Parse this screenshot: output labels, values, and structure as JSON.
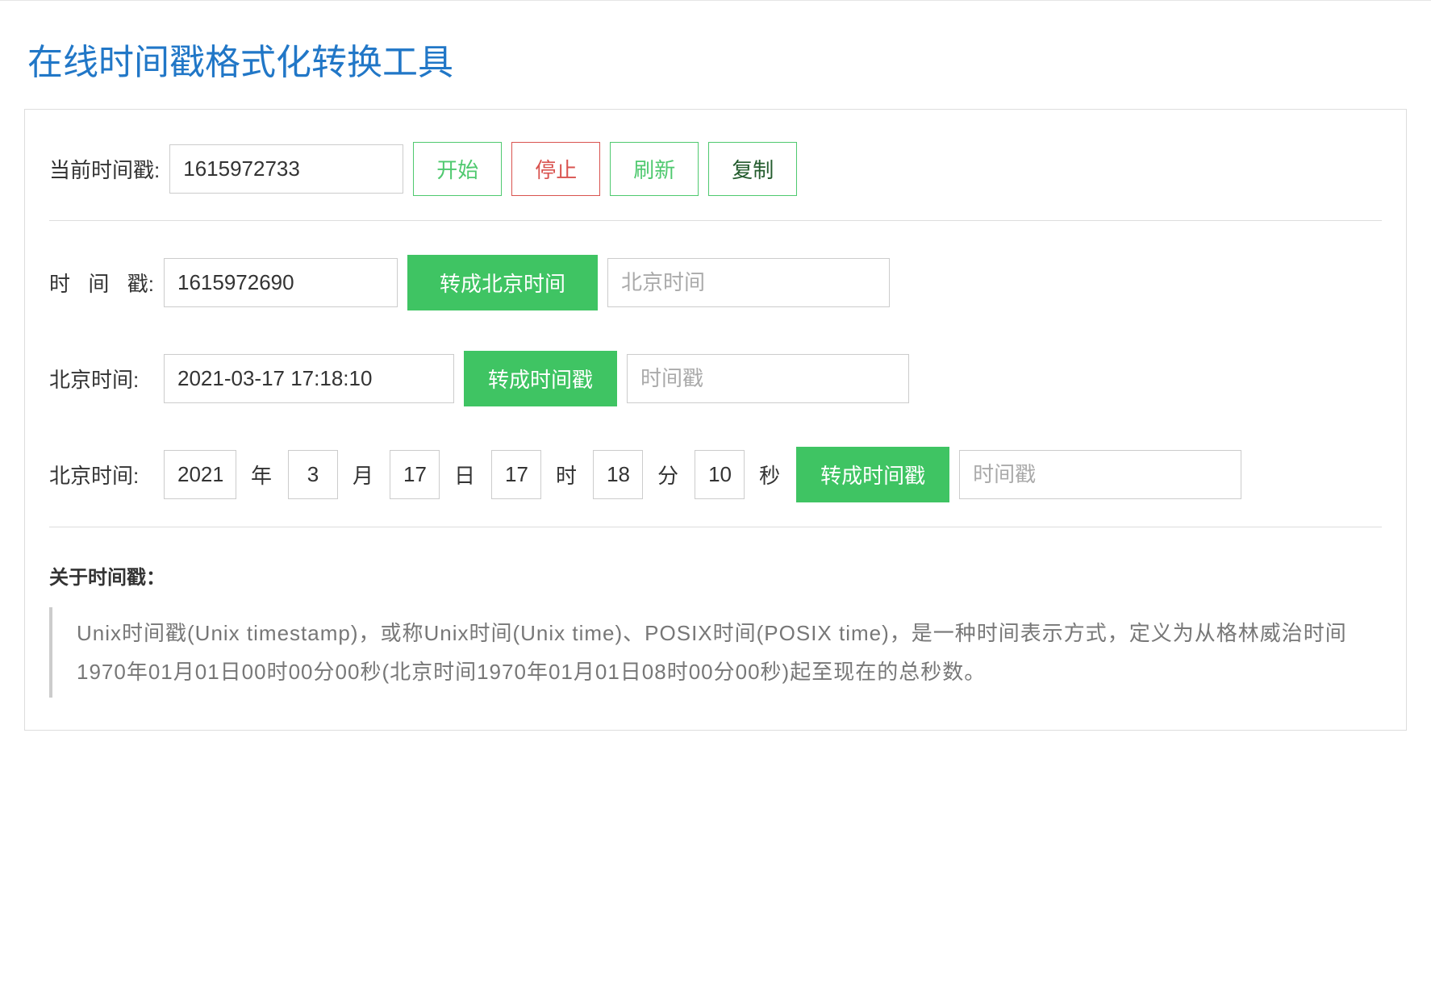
{
  "title": "在线时间戳格式化转换工具",
  "row1": {
    "label": "当前时间戳:",
    "value": "1615972733",
    "btn_start": "开始",
    "btn_stop": "停止",
    "btn_refresh": "刷新",
    "btn_copy": "复制"
  },
  "row2": {
    "label_chars": [
      "时",
      "间",
      "戳:"
    ],
    "value": "1615972690",
    "btn_convert": "转成北京时间",
    "placeholder": "北京时间"
  },
  "row3": {
    "label": "北京时间:",
    "value": "2021-03-17 17:18:10",
    "btn_convert": "转成时间戳",
    "placeholder": "时间戳"
  },
  "row4": {
    "label": "北京时间:",
    "year": "2021",
    "month": "3",
    "day": "17",
    "hour": "17",
    "minute": "18",
    "second": "10",
    "units": {
      "year": "年",
      "month": "月",
      "day": "日",
      "hour": "时",
      "minute": "分",
      "second": "秒"
    },
    "btn_convert": "转成时间戳",
    "placeholder": "时间戳"
  },
  "about": {
    "title": "关于时间戳：",
    "body": "Unix时间戳(Unix timestamp)，或称Unix时间(Unix time)、POSIX时间(POSIX time)，是一种时间表示方式，定义为从格林威治时间1970年01月01日00时00分00秒(北京时间1970年01月01日08时00分00秒)起至现在的总秒数。"
  }
}
